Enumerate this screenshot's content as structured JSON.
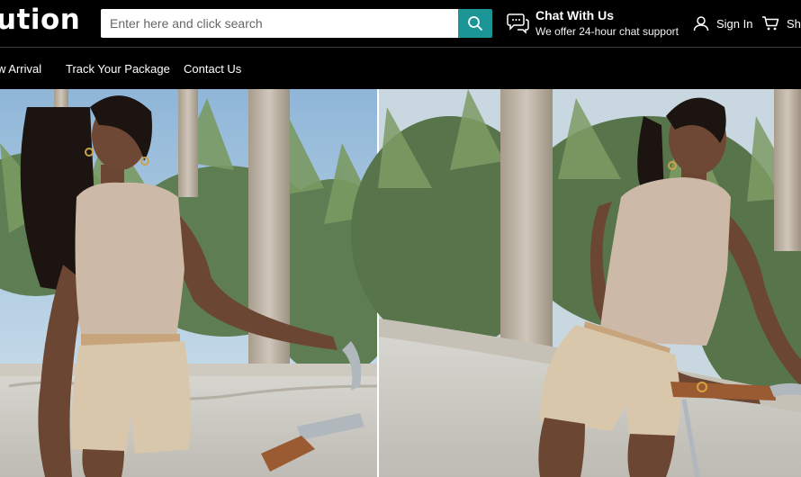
{
  "header": {
    "logo_text": "ution",
    "search": {
      "placeholder": "Enter here and click search",
      "value": ""
    },
    "chat": {
      "title": "Chat With Us",
      "subtitle": "We offer 24-hour chat support"
    },
    "signin_label": "Sign In",
    "cart_label": "Sh"
  },
  "nav": {
    "items": [
      {
        "label": "w Arrival"
      },
      {
        "label": "Track Your Package"
      },
      {
        "label": "Contact Us"
      }
    ]
  },
  "hero": {
    "slides": [
      {
        "name": "left-model-with-bicycle"
      },
      {
        "name": "right-model-with-bicycle"
      }
    ]
  },
  "colors": {
    "header_bg": "#000000",
    "search_button": "#1b9596",
    "top_color": "#cdb9a8",
    "shorts_color": "#d9c7ab"
  }
}
